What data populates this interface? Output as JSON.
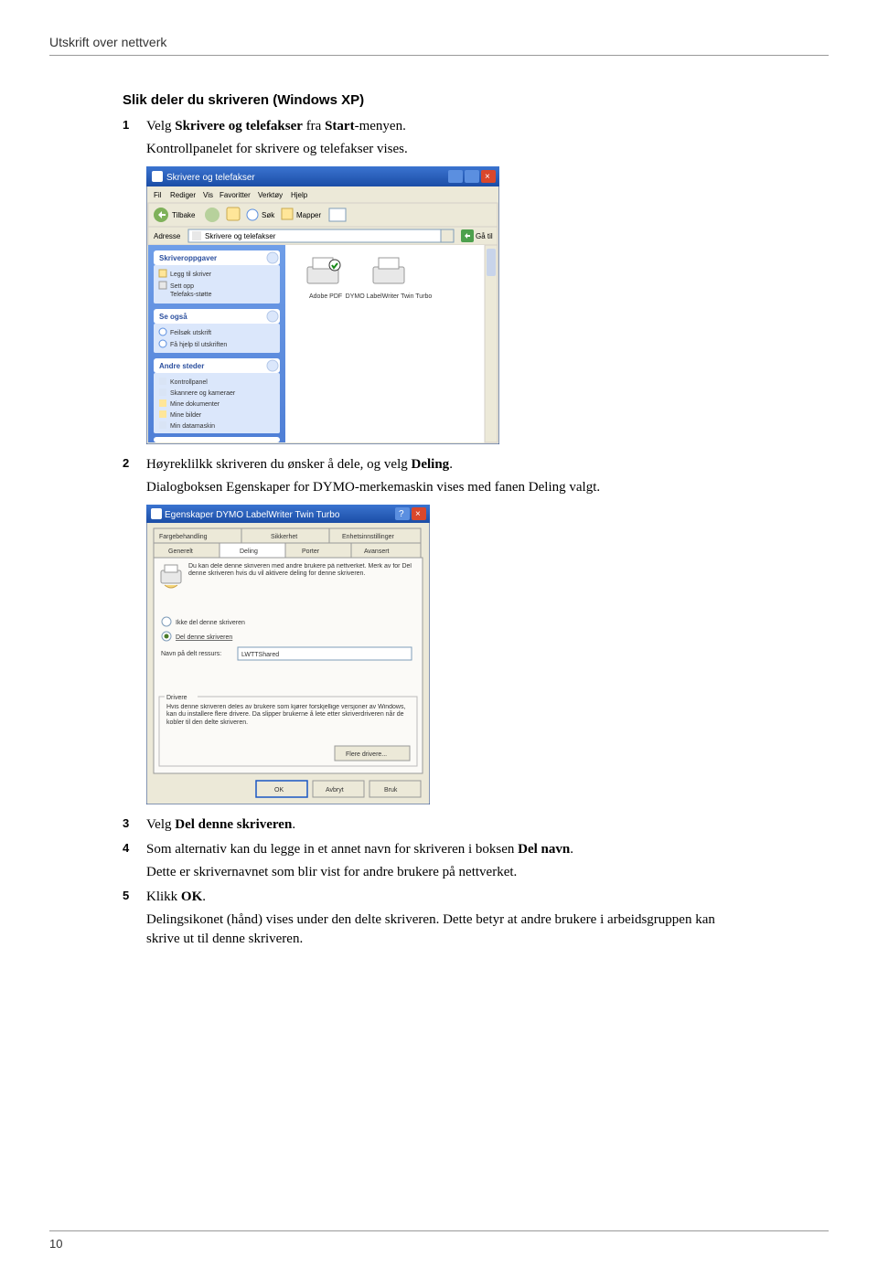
{
  "header": {
    "title": "Utskrift over nettverk"
  },
  "section": {
    "heading": "Slik deler du skriveren (Windows XP)"
  },
  "steps": {
    "s1": {
      "p1a": "Velg ",
      "b1": "Skrivere og telefakser",
      "p1b": " fra ",
      "b2": "Start",
      "p1c": "-menyen.",
      "p2": "Kontrollpanelet for skrivere og telefakser vises."
    },
    "s2": {
      "p1a": "Høyreklilkk skriveren du ønsker å dele, og velg ",
      "b1": "Deling",
      "p1b": ".",
      "p2": "Dialogboksen Egenskaper for DYMO-merkemaskin vises med fanen Deling valgt."
    },
    "s3": {
      "p1a": "Velg ",
      "b1": "Del denne skriveren",
      "p1b": "."
    },
    "s4": {
      "p1a": "Som alternativ kan du legge in et annet navn for skriveren i boksen ",
      "b1": "Del navn",
      "p1b": ".",
      "p2": "Dette er skrivernavnet som blir vist for andre brukere på nettverket."
    },
    "s5": {
      "p1a": "Klikk ",
      "b1": "OK",
      "p1b": ".",
      "p2": "Delingsikonet (hånd) vises under den delte skriveren. Dette betyr at andre brukere i arbeidsgruppen kan skrive ut til denne skriveren."
    }
  },
  "fig1": {
    "title": "Skrivere og telefakser",
    "menu": {
      "fil": "Fil",
      "rediger": "Rediger",
      "vis": "Vis",
      "fav": "Favoritter",
      "verk": "Verktøy",
      "hjelp": "Hjelp"
    },
    "toolbar": {
      "tilbake": "Tilbake",
      "sok": "Søk",
      "mapper": "Mapper"
    },
    "addr_label": "Adresse",
    "addr_value": "Skrivere og telefakser",
    "go": "Gå til",
    "pane1": {
      "head": "Skriveroppgaver",
      "i1": "Legg til skriver",
      "i2": "Sett opp",
      "i2b": "Telefaks-støtte"
    },
    "pane2": {
      "head": "Se også",
      "i1": "Feilsøk utskrift",
      "i2": "Få hjelp til utskriften"
    },
    "pane3": {
      "head": "Andre steder",
      "i1": "Kontrollpanel",
      "i2": "Skannere og kameraer",
      "i3": "Mine dokumenter",
      "i4": "Mine bilder",
      "i5": "Min datamaskin"
    },
    "printers": {
      "p1": "Adobe PDF",
      "p2": "DYMO LabelWriter Twin Turbo"
    }
  },
  "fig2": {
    "title": "Egenskaper DYMO LabelWriter Twin Turbo",
    "tabs": {
      "t1": "Fargebehandling",
      "t2": "Sikkerhet",
      "t3": "Enhetsinnstillinger",
      "t4": "Generelt",
      "t5": "Deling",
      "t6": "Porter",
      "t7": "Avansert"
    },
    "desc": "Du kan dele denne skriveren med andre brukere på nettverket. Merk av for Del denne skriveren hvis du vil aktivere deling for denne skriveren.",
    "r1": "Ikke del denne skriveren",
    "r2": "Del denne skriveren",
    "share_label": "Navn på delt ressurs:",
    "share_value": "LWTTShared",
    "drivers_head": "Drivere",
    "drivers_text": "Hvis denne skriveren deles av brukere som kjører forskjellige versjoner av Windows, kan du installere flere drivere. Da slipper brukerne å lete etter skriverdriveren når de kobler til den delte skriveren.",
    "drivers_btn": "Flere drivere...",
    "ok": "OK",
    "cancel": "Avbryt",
    "apply": "Bruk"
  },
  "footer": {
    "page": "10"
  }
}
